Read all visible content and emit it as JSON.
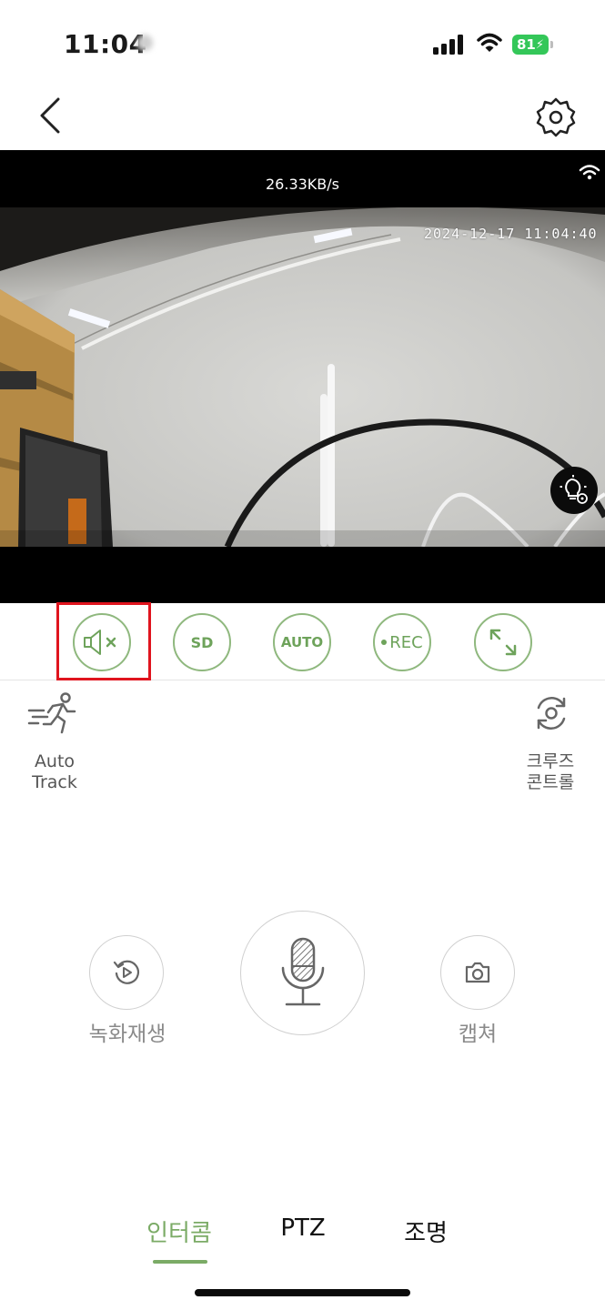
{
  "status_bar": {
    "time": "11:04",
    "battery": "81",
    "icons": [
      "signal-icon",
      "wifi-icon",
      "battery-charging-icon"
    ]
  },
  "nav": {
    "back_icon": "chevron-left-icon",
    "settings_icon": "gear-icon"
  },
  "video": {
    "bitrate": "26.33KB/s",
    "timestamp": "2024-12-17 11:04:40",
    "wifi_icon": "wifi-icon",
    "light_settings_icon": "lightbulb-gear-icon"
  },
  "controls": {
    "mute_icon": "speaker-muted-icon",
    "sd_label": "SD",
    "auto_label": "AUTO",
    "rec_label": "REC",
    "fullscreen_icon": "expand-icon"
  },
  "features": {
    "auto_track": {
      "line1": "Auto",
      "line2": "Track",
      "icon": "running-person-icon"
    },
    "cruise": {
      "line1": "크루즈",
      "line2": "콘트롤",
      "icon": "rotate-icon"
    }
  },
  "actions": {
    "playback_label": "녹화재생",
    "capture_label": "캡쳐",
    "mic_icon": "microphone-icon"
  },
  "tabs": [
    {
      "label": "인터콤",
      "active": true
    },
    {
      "label": "PTZ",
      "active": false
    },
    {
      "label": "조명",
      "active": false
    }
  ],
  "colors": {
    "accent": "#7bab66",
    "highlight": "#e0141e"
  }
}
